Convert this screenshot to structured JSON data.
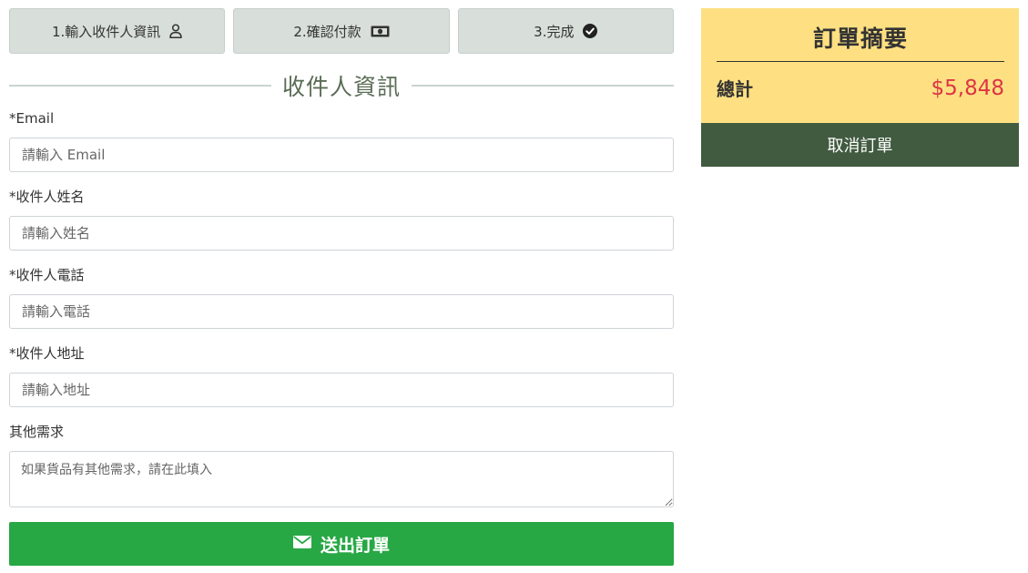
{
  "steps": [
    {
      "label": "1.輸入收件人資訊",
      "icon": "user-icon"
    },
    {
      "label": "2.確認付款",
      "icon": "money-bill-icon"
    },
    {
      "label": "3.完成",
      "icon": "check-circle-icon"
    }
  ],
  "form": {
    "section_title": "收件人資訊",
    "email": {
      "label": "*Email",
      "placeholder": "請輸入 Email"
    },
    "name": {
      "label": "*收件人姓名",
      "placeholder": "請輸入姓名"
    },
    "phone": {
      "label": "*收件人電話",
      "placeholder": "請輸入電話"
    },
    "address": {
      "label": "*收件人地址",
      "placeholder": "請輸入地址"
    },
    "notes": {
      "label": "其他需求",
      "placeholder": "如果貨品有其他需求，請在此填入"
    },
    "submit": {
      "label": "送出訂單",
      "icon": "envelope-icon"
    }
  },
  "summary": {
    "title": "訂單摘要",
    "total_label": "總計",
    "total_value": "$5,848",
    "cancel_label": "取消訂單"
  },
  "colors": {
    "step_bg": "#d8dfdb",
    "section_title": "#5a6c55",
    "submit_bg": "#28a745",
    "summary_bg": "#fee082",
    "total_value": "#dc3545",
    "cancel_bg": "#415b40"
  }
}
